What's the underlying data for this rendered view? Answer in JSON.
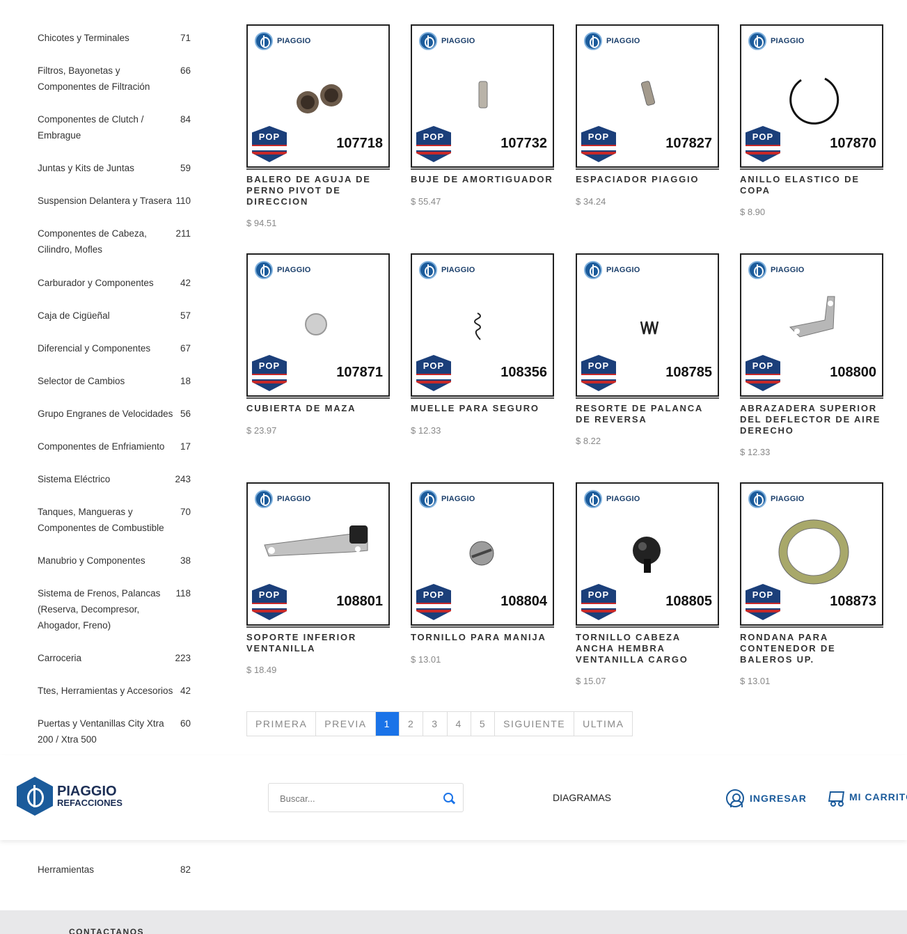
{
  "sidebar": {
    "categories": [
      {
        "name": "Chicotes y Terminales",
        "count": "71"
      },
      {
        "name": "Filtros, Bayonetas y Componentes de Filtración",
        "count": "66"
      },
      {
        "name": "Componentes de Clutch / Embrague",
        "count": "84"
      },
      {
        "name": "Juntas y Kits de Juntas",
        "count": "59"
      },
      {
        "name": "Suspension Delantera y Trasera",
        "count": "110"
      },
      {
        "name": "Componentes de Cabeza, Cilindro, Mofles",
        "count": "211"
      },
      {
        "name": "Carburador y Componentes",
        "count": "42"
      },
      {
        "name": "Caja de Cigüeñal",
        "count": "57"
      },
      {
        "name": "Diferencial y Componentes",
        "count": "67"
      },
      {
        "name": "Selector de Cambios",
        "count": "18"
      },
      {
        "name": "Grupo Engranes de Velocidades",
        "count": "56"
      },
      {
        "name": "Componentes de Enfriamiento",
        "count": "17"
      },
      {
        "name": "Sistema Eléctrico",
        "count": "243"
      },
      {
        "name": "Tanques, Mangueras y Componentes de Combustible",
        "count": "70"
      },
      {
        "name": "Manubrio y Componentes",
        "count": "38"
      },
      {
        "name": "Sistema de Frenos, Palancas (Reserva, Decompresor, Ahogador, Freno)",
        "count": "118"
      },
      {
        "name": "Carroceria",
        "count": "223"
      },
      {
        "name": "Ttes, Herramientas y Accesorios",
        "count": "42"
      },
      {
        "name": "Puertas y Ventanillas City Xtra 200 / Xtra 500",
        "count": "60"
      },
      {
        "name": "Herramientas",
        "count": "82"
      }
    ]
  },
  "brand_label": "PIAGGIO",
  "pop_label": "POP",
  "products": [
    {
      "sku": "107718",
      "title": "BALERO DE AGUJA DE PERNO PIVOT DE DIRECCION",
      "price": "$ 94.51",
      "icon": "needle-bearing-pair"
    },
    {
      "sku": "107732",
      "title": "BUJE DE AMORTIGUADOR",
      "price": "$ 55.47",
      "icon": "bushing"
    },
    {
      "sku": "107827",
      "title": "ESPACIADOR PIAGGIO",
      "price": "$ 34.24",
      "icon": "spacer"
    },
    {
      "sku": "107870",
      "title": "ANILLO ELASTICO DE COPA",
      "price": "$ 8.90",
      "icon": "snap-ring"
    },
    {
      "sku": "107871",
      "title": "CUBIERTA DE MAZA",
      "price": "$ 23.97",
      "icon": "hub-cap"
    },
    {
      "sku": "108356",
      "title": "MUELLE PARA SEGURO",
      "price": "$ 12.33",
      "icon": "small-spring"
    },
    {
      "sku": "108785",
      "title": "RESORTE DE PALANCA DE REVERSA",
      "price": "$ 8.22",
      "icon": "coil-spring"
    },
    {
      "sku": "108800",
      "title": "ABRAZADERA SUPERIOR DEL DEFLECTOR DE AIRE DERECHO",
      "price": "$ 12.33",
      "icon": "bracket"
    },
    {
      "sku": "108801",
      "title": "SOPORTE INFERIOR VENTANILLA",
      "price": "$ 18.49",
      "icon": "support-bar"
    },
    {
      "sku": "108804",
      "title": "TORNILLO PARA MANIJA",
      "price": "$ 13.01",
      "icon": "screw-head"
    },
    {
      "sku": "108805",
      "title": "TORNILLO CABEZA ANCHA HEMBRA VENTANILLA CARGO",
      "price": "$ 15.07",
      "icon": "wide-screw"
    },
    {
      "sku": "108873",
      "title": "RONDANA PARA CONTENEDOR DE BALEROS UP.",
      "price": "$ 13.01",
      "icon": "washer"
    }
  ],
  "pagination": {
    "first": "PRIMERA",
    "prev": "PREVIA",
    "pages": [
      "1",
      "2",
      "3",
      "4",
      "5"
    ],
    "current": "1",
    "next": "SIGUIENTE",
    "last": "ULTIMA"
  },
  "header": {
    "logo_line1": "PIAGGIO",
    "logo_line2": "REFACCIONES",
    "search_placeholder": "Buscar...",
    "diagrams": "DIAGRAMAS",
    "login": "INGRESAR",
    "cart": "MI CARRITO"
  },
  "footer": {
    "contact": "CONTACTANOS"
  },
  "colors": {
    "accent": "#1a73e8",
    "brand_blue": "#1b5b9b"
  }
}
